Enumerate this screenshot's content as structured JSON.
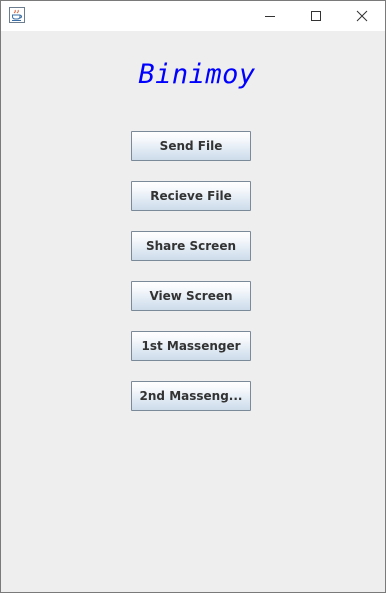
{
  "window": {
    "app_icon": "java-coffee-cup-icon",
    "controls": [
      "minimize-icon",
      "maximize-icon",
      "close-icon"
    ]
  },
  "main": {
    "title": "Binimoy",
    "buttons": [
      {
        "label": "Send File"
      },
      {
        "label": "Recieve File"
      },
      {
        "label": "Share Screen"
      },
      {
        "label": "View Screen"
      },
      {
        "label": "1st Massenger"
      },
      {
        "label": "2nd Masseng..."
      }
    ]
  },
  "colors": {
    "title_text": "#0000ff",
    "background": "#eeeeee",
    "button_text": "#333333"
  }
}
